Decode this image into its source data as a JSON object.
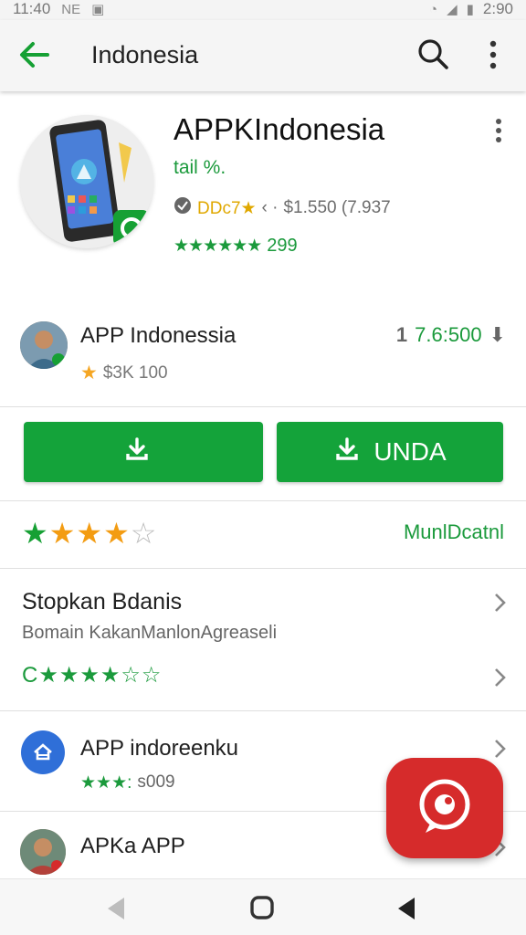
{
  "status_bar": {
    "time_left": "11:40",
    "glyph_left": "NE",
    "time_right": "2:90"
  },
  "app_bar": {
    "title": "Indonesia"
  },
  "header": {
    "title": "APPKIndonesia",
    "subtitle": "tail %.",
    "meta_label": "DDc7★",
    "meta_price": "$1.550 (7.937",
    "rating_count": "299"
  },
  "developer": {
    "name": "APP Indonessia",
    "sub_value": "$3K 100",
    "count": "7.6:500"
  },
  "buttons": {
    "left_label": "",
    "right_label": "UNDA"
  },
  "rating": {
    "stars_filled": 4,
    "stars_total": 5,
    "link": "MunlDcatnl"
  },
  "section": {
    "title": "Stopkan Bdanis",
    "subtitle": "Bomain KakanManlonAgreaseli"
  },
  "list": [
    {
      "title": "APP indoreenku",
      "sub_stars": "★★★:",
      "sub_text": "s009"
    },
    {
      "title": "APKa APP"
    }
  ],
  "colors": {
    "accent_green": "#14a33a",
    "fab_red": "#d62b2b",
    "star_orange": "#f39c12"
  }
}
